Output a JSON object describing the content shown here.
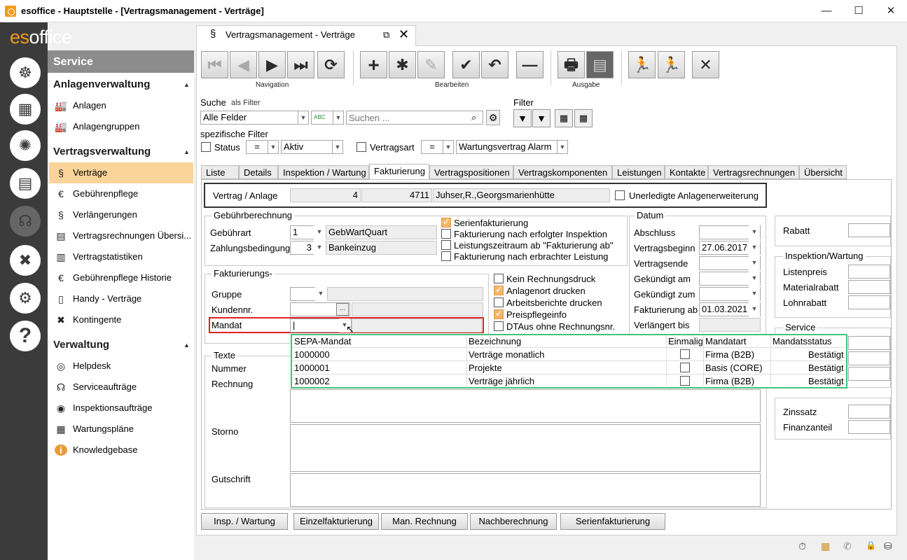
{
  "window": {
    "title": "esoffice - Hauptstelle - [Vertragsmanagement - Verträge]",
    "minimize": "—",
    "maximize": "☐",
    "close": "✕"
  },
  "logo": {
    "part1": "es",
    "part2": "office"
  },
  "sidebar": {
    "header": "Service",
    "sections": [
      {
        "title": "Anlagenverwaltung",
        "items": [
          {
            "label": "Anlagen",
            "icon": "factory-icon"
          },
          {
            "label": "Anlagengruppen",
            "icon": "factory-group-icon"
          }
        ]
      },
      {
        "title": "Vertragsverwaltung",
        "items": [
          {
            "label": "Verträge",
            "icon": "paragraph-icon",
            "active": true
          },
          {
            "label": "Gebührenpflege",
            "icon": "money-bag-icon"
          },
          {
            "label": "Verlängerungen",
            "icon": "renew-icon"
          },
          {
            "label": "Vertragsrechnungen Übersi...",
            "icon": "invoice-icon"
          },
          {
            "label": "Vertragstatistiken",
            "icon": "statistics-icon"
          },
          {
            "label": "Gebührenpflege Historie",
            "icon": "history-icon"
          },
          {
            "label": "Handy - Verträge",
            "icon": "mobile-icon"
          },
          {
            "label": "Kontingente",
            "icon": "tools-icon"
          }
        ]
      },
      {
        "title": "Verwaltung",
        "items": [
          {
            "label": "Helpdesk",
            "icon": "lifebuoy-icon"
          },
          {
            "label": "Serviceaufträge",
            "icon": "headset-icon"
          },
          {
            "label": "Inspektionsaufträge",
            "icon": "eye-icon"
          },
          {
            "label": "Wartungspläne",
            "icon": "calendar-icon"
          },
          {
            "label": "Knowledgebase",
            "icon": "info-icon"
          }
        ]
      }
    ]
  },
  "doc_tab": {
    "symbol": "§",
    "title": "Vertragsmanagement - Verträge",
    "popout": "⧉",
    "close": "✕"
  },
  "toolbar": {
    "navigation_label": "Navigation",
    "bearbeiten_label": "Bearbeiten",
    "ausgabe_label": "Ausgabe",
    "buttons": [
      "⏮",
      "◀",
      "▶",
      "⏭",
      "⟳",
      "+",
      "✱",
      "✎",
      "✔",
      "↶",
      "—",
      "🖶",
      "▤",
      "🏃",
      "🏃",
      "✕"
    ]
  },
  "search": {
    "label": "Suche",
    "as_filter": "als Filter",
    "field_select": "Alle Felder",
    "type_icon": "ABC",
    "placeholder": "Suchen ...",
    "filter_label": "Filter",
    "specific_filter": "spezifische Filter",
    "status_label": "Status",
    "status_op": "=",
    "status_value": "Aktiv",
    "vertragsart_label": "Vertragsart",
    "vertragsart_op": "=",
    "vertragsart_value": "Wartungsvertrag Alarm"
  },
  "tabs": [
    "Liste",
    "Details",
    "Inspektion / Wartung",
    "Fakturierung",
    "Vertragspositionen",
    "Vertragskomponenten",
    "Leistungen",
    "Kontakte",
    "Vertragsrechnungen",
    "Übersicht"
  ],
  "active_tab": "Fakturierung",
  "vertrag": {
    "label": "Vertrag / Anlage",
    "num1": "4",
    "num2": "4711",
    "name": "Juhser,R.,Georgsmarienhütte",
    "unerledigte": "Unerledigte Anlagenerweiterung"
  },
  "gebuehr": {
    "title": "Gebührberechnung",
    "gebuehrart_label": "Gebührart",
    "gebuehrart_num": "1",
    "gebuehrart_text": "GebWartQuart",
    "zahlung_label": "Zahlungsbedingung",
    "zahlung_num": "3",
    "zahlung_text": "Bankeinzug",
    "checks": [
      {
        "label": "Serienfakturierung",
        "checked": true
      },
      {
        "label": "Fakturierung nach erfolgter Inspektion",
        "checked": false
      },
      {
        "label": "Leistungszeitraum ab \"Fakturierung ab\"",
        "checked": false
      },
      {
        "label": "Fakturierung nach erbrachter Leistung",
        "checked": false
      }
    ]
  },
  "faktur": {
    "title": "Fakturierungs-",
    "gruppe_label": "Gruppe",
    "kundennr_label": "Kundennr.",
    "mandat_label": "Mandat",
    "mandat_value": "|",
    "ellipsis": "···",
    "checks": [
      {
        "label": "Kein Rechnungsdruck",
        "checked": false
      },
      {
        "label": "Anlagenort drucken",
        "checked": true
      },
      {
        "label": "Arbeitsberichte drucken",
        "checked": false
      },
      {
        "label": "Preispflegeinfo",
        "checked": true
      },
      {
        "label": "DTAus ohne Rechnungsnr.",
        "checked": false
      }
    ]
  },
  "datum": {
    "title": "Datum",
    "abschluss": "Abschluss",
    "vertragsbeginn": "Vertragsbeginn",
    "vertragsbeginn_value": "27.06.2017",
    "vertragsende": "Vertragsende",
    "gekuendigt_am": "Gekündigt am",
    "gekuendigt_zum": "Gekündigt zum",
    "fakturierung_ab": "Fakturierung ab",
    "fakturierung_ab_value": "01.03.2021",
    "verlaengert_bis": "Verlängert bis"
  },
  "right": {
    "rabatt": "Rabatt",
    "inspektion_title": "Inspektion/Wartung",
    "listenpreis": "Listenpreis",
    "materialrabatt": "Materialrabatt",
    "lohnrabatt": "Lohnrabatt",
    "service_title": "Service",
    "zinssatz": "Zinssatz",
    "finanzanteil": "Finanzanteil"
  },
  "texte": {
    "title": "Texte",
    "nummer": "Nummer",
    "rechnung": "Rechnung",
    "storno": "Storno",
    "gutschrift": "Gutschrift"
  },
  "mandat_grid": {
    "headers": [
      "SEPA-Mandat",
      "Bezeichnung",
      "Einmalig",
      "Mandatart",
      "Mandatsstatus"
    ],
    "rows": [
      {
        "sepa": "1000000",
        "bez": "Verträge monatlich",
        "einmalig": false,
        "art": "Firma (B2B)",
        "status": "Bestätigt"
      },
      {
        "sepa": "1000001",
        "bez": "Projekte",
        "einmalig": false,
        "art": "Basis (CORE)",
        "status": "Bestätigt"
      },
      {
        "sepa": "1000002",
        "bez": "Verträge jährlich",
        "einmalig": false,
        "art": "Firma (B2B)",
        "status": "Bestätigt"
      }
    ]
  },
  "bottom_buttons": [
    "Insp. / Wartung",
    "Einzelfakturierung",
    "Man. Rechnung",
    "Nachberechnung",
    "Serienfakturierung"
  ],
  "statusbar": [
    "⏱",
    "▦",
    "✆",
    "🔒",
    "⛁"
  ]
}
